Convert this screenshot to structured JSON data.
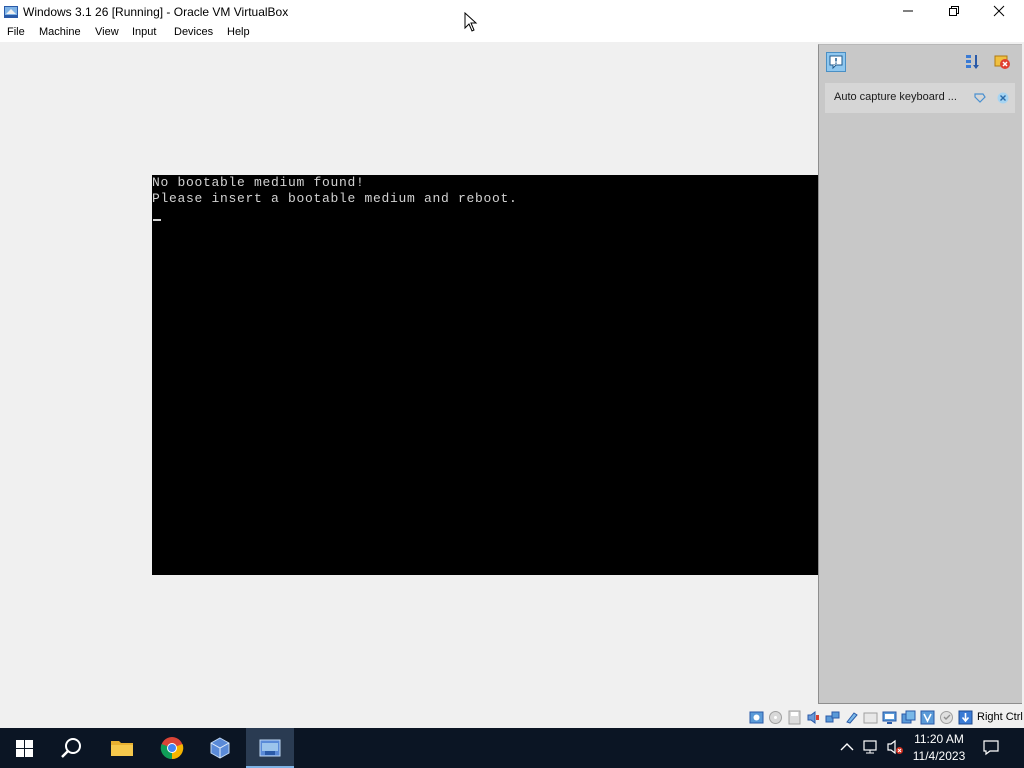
{
  "window": {
    "title": "Windows 3.1 26 [Running] - Oracle VM VirtualBox",
    "controls": [
      "minimize",
      "maximize",
      "close"
    ]
  },
  "menu": {
    "items": [
      "File",
      "Machine",
      "View",
      "Input",
      "Devices",
      "Help"
    ]
  },
  "vm_screen": {
    "lines": [
      "No bootable medium found!",
      "Please insert a bootable medium and reboot."
    ]
  },
  "notifications": {
    "card_text": "Auto capture keyboard ...",
    "icons": [
      "notification-center-icon",
      "sort-icon",
      "dismiss-all-icon",
      "pin-icon",
      "close-icon"
    ]
  },
  "statusbar": {
    "host_key": "Right Ctrl",
    "icons": [
      "hard-disk-icon",
      "optical-drive-icon",
      "floppy-icon",
      "audio-icon",
      "network-icon",
      "usb-icon",
      "shared-folders-icon",
      "display-icon",
      "recording-icon",
      "vt-x-icon",
      "mouse-integration-icon",
      "keyboard-capture-icon"
    ]
  },
  "taskbar": {
    "apps": [
      "start-icon",
      "search-icon",
      "file-explorer-icon",
      "chrome-icon",
      "virtualbox-icon",
      "vm-window-icon"
    ],
    "time": "11:20 AM",
    "date": "11/4/2023"
  },
  "colors": {
    "titlebar": "#ffffff",
    "vm_background": "#000000",
    "vm_text": "#d2d2d2",
    "taskbar": "#0b1524",
    "panel": "#c8c8c8"
  }
}
